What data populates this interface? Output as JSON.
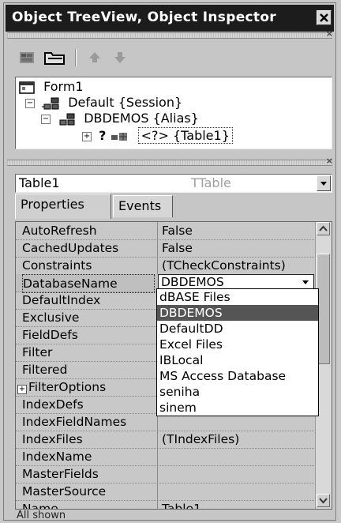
{
  "window": {
    "title": "Object TreeView, Object Inspector"
  },
  "tree": {
    "items": [
      {
        "label": "Form1"
      },
      {
        "label": "Default {Session}"
      },
      {
        "label": "DBDEMOS {Alias}"
      },
      {
        "label": "<?> {Table1}"
      }
    ]
  },
  "inspector": {
    "object_name": "Table1",
    "object_type": "TTable",
    "tabs": [
      {
        "label": "Properties"
      },
      {
        "label": "Events"
      }
    ],
    "properties": [
      {
        "name": "AutoRefresh",
        "value": "False"
      },
      {
        "name": "CachedUpdates",
        "value": "False"
      },
      {
        "name": "Constraints",
        "value": "(TCheckConstraints)"
      },
      {
        "name": "DatabaseName",
        "value": "DBDEMOS"
      },
      {
        "name": "DefaultIndex",
        "value": ""
      },
      {
        "name": "Exclusive",
        "value": ""
      },
      {
        "name": "FieldDefs",
        "value": ""
      },
      {
        "name": "Filter",
        "value": ""
      },
      {
        "name": "Filtered",
        "value": ""
      },
      {
        "name": "FilterOptions",
        "value": ""
      },
      {
        "name": "IndexDefs",
        "value": ""
      },
      {
        "name": "IndexFieldNames",
        "value": ""
      },
      {
        "name": "IndexFiles",
        "value": "(TIndexFiles)"
      },
      {
        "name": "IndexName",
        "value": ""
      },
      {
        "name": "MasterFields",
        "value": ""
      },
      {
        "name": "MasterSource",
        "value": ""
      },
      {
        "name": "Name",
        "value": "Table1"
      }
    ],
    "dropdown_options": [
      "dBASE Files",
      "DBDEMOS",
      "DefaultDD",
      "Excel Files",
      "IBLocal",
      "MS Access Database",
      "seniha",
      "sinem"
    ],
    "dropdown_selected": "DBDEMOS"
  },
  "status": {
    "text": "All shown"
  }
}
